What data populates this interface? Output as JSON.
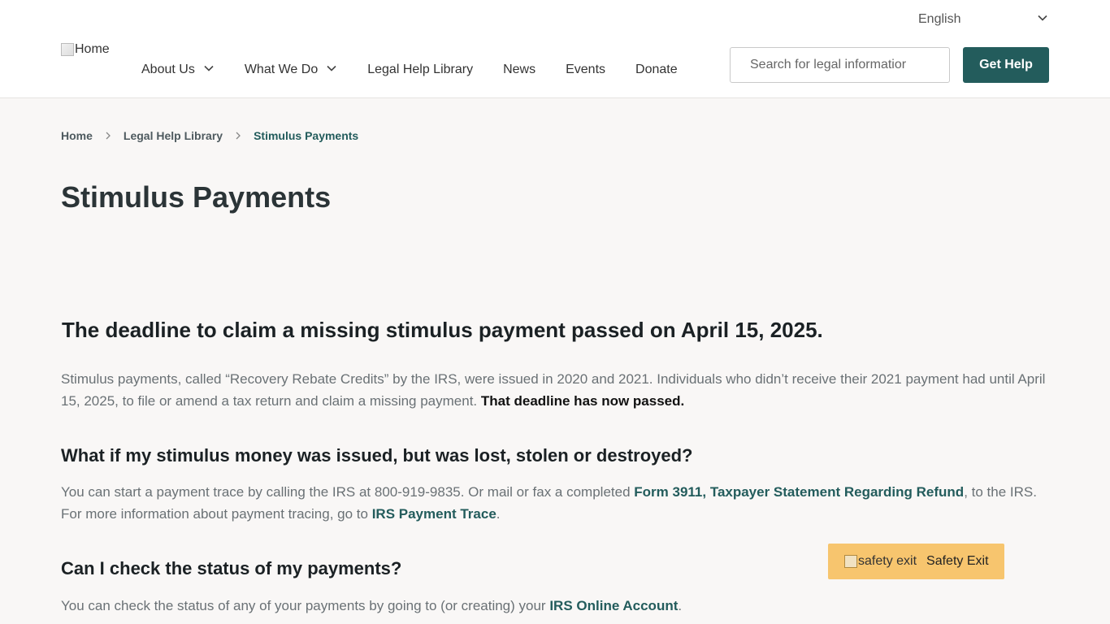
{
  "header": {
    "language": "English",
    "logo_alt": "Home",
    "nav": [
      {
        "label": "About Us"
      },
      {
        "label": "What We Do"
      },
      {
        "label": "Legal Help Library"
      },
      {
        "label": "News"
      },
      {
        "label": "Events"
      },
      {
        "label": "Donate"
      }
    ],
    "search_placeholder": "Search for legal informatior",
    "get_help_label": "Get Help",
    "brand_color": "#235c5c"
  },
  "breadcrumb": {
    "home": "Home",
    "library": "Legal Help Library",
    "current": "Stimulus Payments"
  },
  "page_title": "Stimulus Payments",
  "article": {
    "deadline_heading": "The deadline to claim a missing stimulus payment passed on April 15, 2025.",
    "p1_text": "Stimulus payments, called “Recovery Rebate Credits” by the IRS, were issued in 2020 and 2021. Individuals who didn’t receive their 2021 payment had until April 15, 2025, to file or amend a tax return and claim a missing payment. ",
    "p1_bold": "That deadline has now passed.",
    "lost_heading": "What if my stimulus money was issued, but was lost, stolen or destroyed?",
    "p2_a": "You can start a payment trace by calling the IRS at 800-919-9835. Or mail or fax a completed ",
    "p2_link1": "Form 3911, Taxpayer Statement Regarding Refund",
    "p2_b": ", to the IRS. For more information about payment tracing, go to ",
    "p2_link2": "IRS Payment Trace",
    "p2_c": ".",
    "status_heading": "Can I check the status of my payments?",
    "p3_a": "You can check the status of any of your payments by going to (or creating) your ",
    "p3_link": "IRS Online Account",
    "p3_b": "."
  },
  "safety_exit": {
    "img_alt": "safety exit",
    "label": "Safety Exit",
    "color": "#f7c56e"
  }
}
